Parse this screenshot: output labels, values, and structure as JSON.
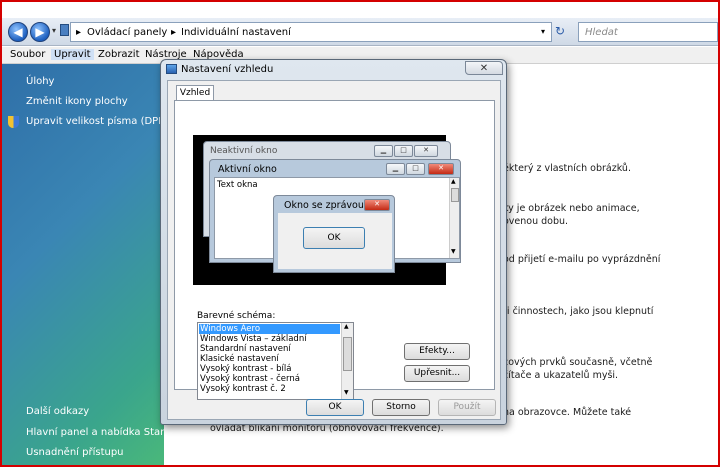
{
  "address": {
    "segments": [
      "Ovládací panely",
      "Individuální nastavení"
    ],
    "search_placeholder": "Hledat"
  },
  "menu": [
    "Soubor",
    "Upravit",
    "Zobrazit",
    "Nástroje",
    "Nápověda"
  ],
  "left_pane": {
    "top_links": [
      "Úlohy",
      "Změnit ikony plochy",
      "Upravit velikost písma (DPI)"
    ],
    "bottom_links": [
      "Další odkazy",
      "Hlavní panel a nabídka Start",
      "Usnadnění přístupu"
    ]
  },
  "background_fragments": [
    "ěkterý z vlastních obrázků.",
    "ky je obrázek nebo animace,",
    "ovenou dobu.",
    "od přijetí e-mailu po vyprázdnění",
    "ři činnostech, jako jsou klepnutí",
    "cových prvků současně, včetně",
    "čítače a ukazatelů myši.",
    "na obrazovce. Můžete také",
    "ovládat blikání monitoru (obnovovací frekvence)."
  ],
  "dialog": {
    "title": "Nastavení vzhledu",
    "close_glyph": "✕",
    "tab": "Vzhled",
    "preview": {
      "inactive_title": "Neaktivní okno",
      "active_title": "Aktivní okno",
      "window_text": "Text okna",
      "message_title": "Okno se zprávou",
      "ok": "OK"
    },
    "scheme_label": "Barevné schéma:",
    "schemes": [
      "Windows Aero",
      "Windows Vista – základní",
      "Standardní nastavení",
      "Klasické nastavení",
      "Vysoký kontrast - bílá",
      "Vysoký kontrast - černá",
      "Vysoký kontrast č. 2"
    ],
    "selected_scheme": "Windows Aero",
    "buttons": {
      "effects": "Efekty...",
      "advanced": "Upřesnit...",
      "ok": "OK",
      "cancel": "Storno",
      "apply": "Použít"
    }
  },
  "colors": {
    "selection": "#3399ff",
    "frame": "#d40000",
    "close": "#c42a14"
  }
}
